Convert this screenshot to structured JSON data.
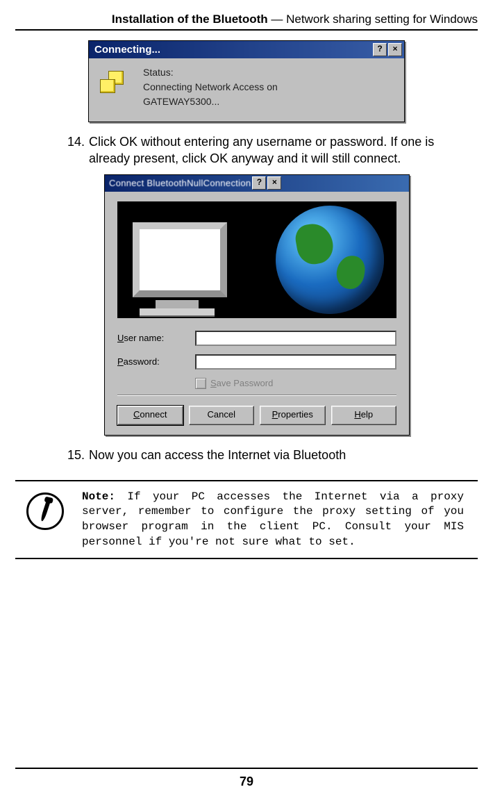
{
  "header": {
    "bold": "Installation of the Bluetooth",
    "rest": " — Network sharing setting for Windows"
  },
  "dlg1": {
    "title": "Connecting...",
    "help_glyph": "?",
    "close_glyph": "×",
    "status_label": "Status:",
    "line1": "Connecting Network Access on",
    "line2": "GATEWAY5300..."
  },
  "steps": {
    "s14": {
      "num": "14.",
      "text": "Click OK without entering any username or password. If one is already present, click OK anyway and it will still connect."
    },
    "s15": {
      "num": "15.",
      "text": "Now you can access the Internet via Bluetooth"
    }
  },
  "dlg2": {
    "title": "Connect BluetoothNullConnection",
    "help_glyph": "?",
    "close_glyph": "×",
    "username_u": "U",
    "username_rest": "ser name:",
    "password_u": "P",
    "password_rest": "assword:",
    "save_u": "S",
    "save_rest": "ave Password",
    "btn_connect_u": "C",
    "btn_connect_rest": "onnect",
    "btn_cancel": "Cancel",
    "btn_properties_u": "P",
    "btn_properties_rest": "roperties",
    "btn_help_u": "H",
    "btn_help_rest": "elp"
  },
  "note": {
    "label": "Note:",
    "body": " If your PC accesses the Internet via a proxy server, remember to configure the proxy setting of you browser program in the client PC. Consult your MIS personnel if you're not sure what to set."
  },
  "page_number": "79"
}
